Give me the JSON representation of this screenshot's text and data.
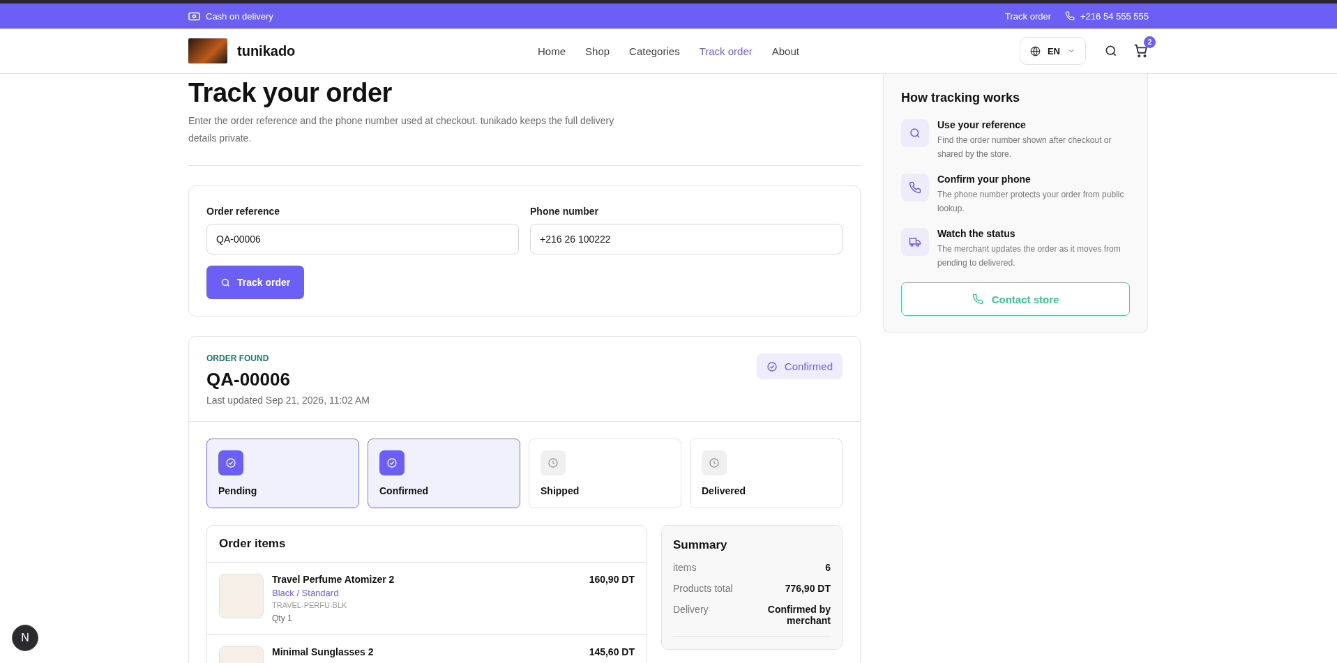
{
  "top_bar": {
    "payment_note": "Cash on delivery",
    "links": [
      {
        "label": "Track order",
        "kind": "link"
      },
      {
        "label": "+216 54 555 555",
        "kind": "phone"
      }
    ]
  },
  "header": {
    "brand": "tunikado",
    "nav": [
      {
        "label": "Home",
        "selected": false
      },
      {
        "label": "Shop",
        "selected": false
      },
      {
        "label": "Categories",
        "selected": false
      },
      {
        "label": "Track order",
        "selected": true
      },
      {
        "label": "About",
        "selected": false
      }
    ],
    "language": "EN",
    "cart_count": "2"
  },
  "page": {
    "title": "Track your order",
    "description": "Enter the order reference and the phone number used at checkout. tunikado keeps the full delivery details private."
  },
  "form": {
    "fields": [
      {
        "label": "Order reference",
        "value": "QA-00006"
      },
      {
        "label": "Phone number",
        "value": "+216 26 100222"
      }
    ],
    "button": "Track order"
  },
  "order": {
    "eyebrow": "ORDER FOUND",
    "reference": "QA-00006",
    "updated": "Last updated Sep 21, 2026, 11:02 AM",
    "status": "Confirmed",
    "steps": [
      {
        "label": "Pending",
        "done": true
      },
      {
        "label": "Confirmed",
        "done": true
      },
      {
        "label": "Shipped",
        "done": false
      },
      {
        "label": "Delivered",
        "done": false
      }
    ],
    "items_title": "Order items",
    "items": [
      {
        "name": "Travel Perfume Atomizer 2",
        "variant": "Black / Standard",
        "sku": "TRAVEL-PERFU-BLK",
        "qty": "Qty 1",
        "price": "160,90 DT"
      },
      {
        "name": "Minimal Sunglasses 2",
        "price": "145,60 DT"
      }
    ],
    "summary": {
      "title": "Summary",
      "rows": [
        {
          "label": "items",
          "value": "6"
        },
        {
          "label": "Products total",
          "value": "776,90 DT"
        },
        {
          "label": "Delivery",
          "value": "Confirmed by merchant"
        }
      ]
    }
  },
  "help": {
    "title": "How tracking works",
    "steps": [
      {
        "kind": "search",
        "title": "Use your reference",
        "text": "Find the order number shown after checkout or shared by the store."
      },
      {
        "kind": "phone",
        "title": "Confirm your phone",
        "text": "The phone number protects your order from public lookup."
      },
      {
        "kind": "truck",
        "title": "Watch the status",
        "text": "The merchant updates the order as it moves from pending to delivered."
      }
    ],
    "button": "Contact store"
  },
  "dev_badge": "N"
}
